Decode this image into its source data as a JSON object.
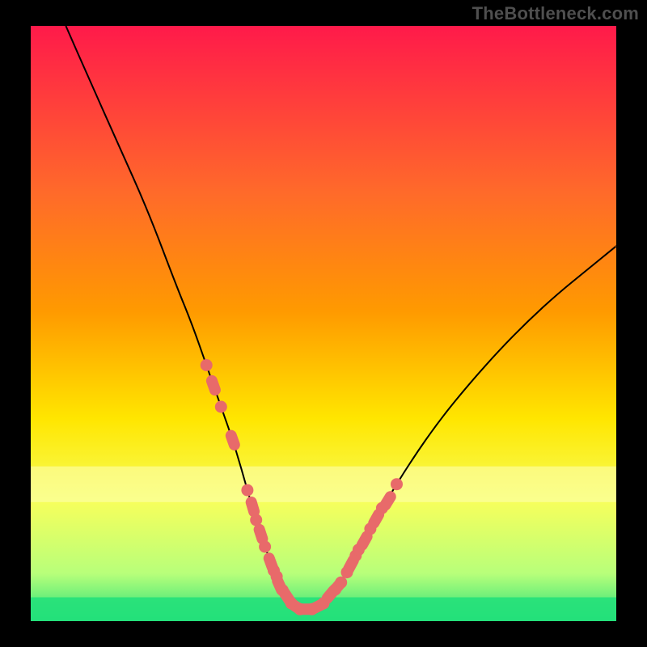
{
  "watermark": "TheBottleneck.com",
  "colors": {
    "background_black": "#000000",
    "gradient_top": "#ff1a4a",
    "gradient_mid1": "#ff8a00",
    "gradient_mid2": "#ffe600",
    "gradient_mid3": "#f6ff5c",
    "gradient_bottom": "#24e07a",
    "curve_stroke": "#000000",
    "marker_fill": "#e86a6a"
  },
  "chart_data": {
    "type": "line",
    "title": "",
    "xlabel": "",
    "ylabel": "",
    "xlim": [
      0,
      100
    ],
    "ylim": [
      0,
      100
    ],
    "grid": false,
    "legend": false,
    "series": [
      {
        "name": "bottleneck-curve",
        "x": [
          6,
          10,
          15,
          20,
          25,
          27.5,
          30,
          32.5,
          35,
          37,
          38.5,
          40,
          41.5,
          43,
          44.5,
          46,
          48,
          50,
          53,
          56,
          60,
          65,
          70,
          75,
          80,
          85,
          90,
          95,
          100
        ],
        "y": [
          100,
          91,
          80,
          69,
          56,
          50,
          43,
          36,
          29,
          22,
          17,
          12.5,
          8.5,
          5.2,
          3,
          2,
          2,
          3,
          6.5,
          12,
          19,
          27,
          34,
          40,
          45.5,
          50.5,
          55,
          59,
          63
        ]
      }
    ],
    "markers": [
      {
        "x": 30,
        "y": 43,
        "kind": "dot"
      },
      {
        "x": 31.2,
        "y": 39.6,
        "kind": "pill"
      },
      {
        "x": 32.5,
        "y": 36,
        "kind": "dot"
      },
      {
        "x": 34.5,
        "y": 30.4,
        "kind": "pill"
      },
      {
        "x": 37,
        "y": 22,
        "kind": "dot"
      },
      {
        "x": 37.9,
        "y": 19.2,
        "kind": "pill"
      },
      {
        "x": 38.5,
        "y": 17,
        "kind": "dot"
      },
      {
        "x": 39.3,
        "y": 14.6,
        "kind": "pill"
      },
      {
        "x": 40,
        "y": 12.5,
        "kind": "dot"
      },
      {
        "x": 41,
        "y": 9.8,
        "kind": "pill"
      },
      {
        "x": 41.5,
        "y": 8.5,
        "kind": "dot"
      },
      {
        "x": 42,
        "y": 7.5,
        "kind": "dot"
      },
      {
        "x": 42.5,
        "y": 6.0,
        "kind": "pill"
      },
      {
        "x": 43,
        "y": 5.2,
        "kind": "dot"
      },
      {
        "x": 43.7,
        "y": 4.2,
        "kind": "pill"
      },
      {
        "x": 44.5,
        "y": 3,
        "kind": "dot"
      },
      {
        "x": 45.2,
        "y": 2.5,
        "kind": "pill"
      },
      {
        "x": 46,
        "y": 2,
        "kind": "dot"
      },
      {
        "x": 46.8,
        "y": 2,
        "kind": "pill"
      },
      {
        "x": 48,
        "y": 2,
        "kind": "dot"
      },
      {
        "x": 49.1,
        "y": 2.5,
        "kind": "pill"
      },
      {
        "x": 50,
        "y": 3,
        "kind": "dot"
      },
      {
        "x": 51.2,
        "y": 4.5,
        "kind": "pill"
      },
      {
        "x": 52,
        "y": 5.3,
        "kind": "dot"
      },
      {
        "x": 52.5,
        "y": 5.9,
        "kind": "pill"
      },
      {
        "x": 53,
        "y": 6.5,
        "kind": "dot"
      },
      {
        "x": 54,
        "y": 8.2,
        "kind": "dot"
      },
      {
        "x": 54.7,
        "y": 9.5,
        "kind": "pill"
      },
      {
        "x": 55.5,
        "y": 11.0,
        "kind": "dot"
      },
      {
        "x": 56,
        "y": 12,
        "kind": "dot"
      },
      {
        "x": 57,
        "y": 13.5,
        "kind": "pill"
      },
      {
        "x": 58,
        "y": 15.5,
        "kind": "dot"
      },
      {
        "x": 59,
        "y": 17.2,
        "kind": "pill"
      },
      {
        "x": 60,
        "y": 19,
        "kind": "dot"
      },
      {
        "x": 61,
        "y": 20.2,
        "kind": "pill"
      },
      {
        "x": 62.5,
        "y": 23,
        "kind": "dot"
      }
    ],
    "bands": [
      {
        "name": "pale-yellow-band",
        "y0": 20,
        "y1": 26,
        "color": "#fdffb8"
      },
      {
        "name": "green-band",
        "y0": 0,
        "y1": 4,
        "color": "#24e07a"
      }
    ]
  }
}
